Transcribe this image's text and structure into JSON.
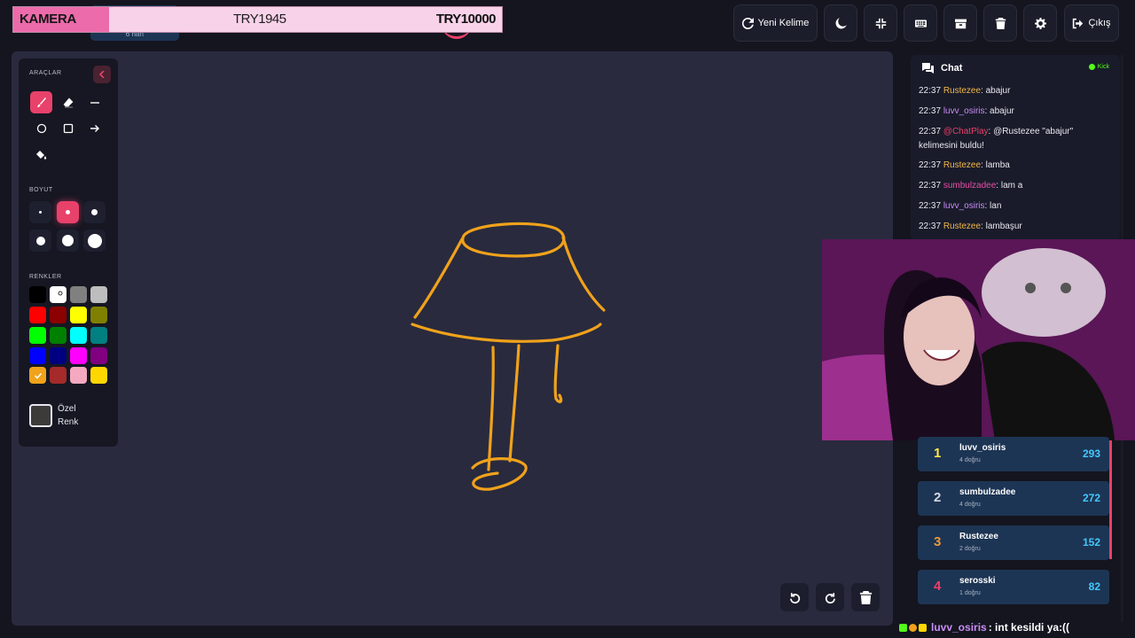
{
  "donation": {
    "label": "KAMERA",
    "current": "TRY1945",
    "target": "TRY10000"
  },
  "word": {
    "length": "6 harf"
  },
  "toolbar": {
    "new_word_label": "Yeni Kelime",
    "exit_label": "Çıkış",
    "buttons": [
      "refresh-icon",
      "moon-icon",
      "compress-icon",
      "keyboard-icon",
      "archive-icon",
      "trash-icon",
      "gear-icon",
      "sign-out-icon"
    ]
  },
  "tools": {
    "title": "ARAÇLAR",
    "size_title": "BOYUT",
    "colors_title": "RENKLER",
    "custom_line1": "Özel",
    "custom_line2": "Renk",
    "active_tool": "brush",
    "active_size_index": 1,
    "selected_color": "#f0a21b",
    "colors": [
      "#000000",
      "#ffffff",
      "#808080",
      "#bdbdbd",
      "#ff0000",
      "#8b0000",
      "#ffff00",
      "#808000",
      "#00ff00",
      "#008000",
      "#00ffff",
      "#008080",
      "#0000ff",
      "#000080",
      "#ff00ff",
      "#800080",
      "#f0a21b",
      "#a52a2a",
      "#f4a9c0",
      "#ffd700"
    ]
  },
  "drawing": {
    "stroke_color": "#f0a21b"
  },
  "chat": {
    "title": "Chat",
    "platform": "Kick",
    "messages": [
      {
        "time": "22:37",
        "user": "Rustezee",
        "color": "#f2b84b",
        "sep": ":",
        "text": " abajur"
      },
      {
        "time": "22:37",
        "user": "luvv_osiris",
        "color": "#c98df5",
        "sep": ":",
        "text": " abajur"
      },
      {
        "time": "22:37",
        "user": "@ChatPlay",
        "color": "#e8416a",
        "sep": ":",
        "text": " @Rustezee \"abajur\"",
        "text2": "kelimesini buldu!"
      },
      {
        "time": "22:37",
        "user": "Rustezee",
        "color": "#f2b84b",
        "sep": ":",
        "text": " lamba"
      },
      {
        "time": "22:37",
        "user": "sumbulzadee",
        "color": "#e84ea8",
        "sep": ":",
        "text": " lam a"
      },
      {
        "time": "22:37",
        "user": "luvv_osiris",
        "color": "#c98df5",
        "sep": ":",
        "text": " lan"
      },
      {
        "time": "22:37",
        "user": "Rustezee",
        "color": "#f2b84b",
        "sep": ":",
        "text": " lambaşur"
      }
    ]
  },
  "leaderboard": [
    {
      "rank": "1",
      "rank_color": "#ffe84d",
      "name": "luvv_osiris",
      "sub": "4 doğru",
      "score": "293"
    },
    {
      "rank": "2",
      "rank_color": "#d4d8e2",
      "name": "sumbulzadee",
      "sub": "4 doğru",
      "score": "272"
    },
    {
      "rank": "3",
      "rank_color": "#e89a3c",
      "name": "Rustezee",
      "sub": "2 doğru",
      "score": "152"
    },
    {
      "rank": "4",
      "rank_color": "#e8416a",
      "name": "serosski",
      "sub": "1 doğru",
      "score": "82"
    }
  ],
  "ticker": {
    "user": "luvv_osiris",
    "text": ": int kesildi ya:(("
  }
}
